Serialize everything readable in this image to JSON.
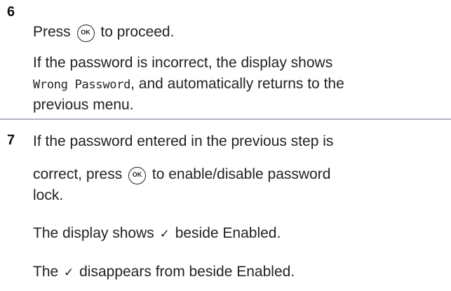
{
  "step6": {
    "number": "6",
    "line1_before": "Press",
    "ok_icon": "OK",
    "line1_after": "to proceed.",
    "para_line1": "If the password is incorrect, the display shows",
    "lcd_text": "Wrong Password",
    "para_line2_after": ", and automatically returns to the",
    "para_line3": "previous menu."
  },
  "step7": {
    "number": "7",
    "line1": "If the password entered in the previous step is",
    "line2_before": "correct, press",
    "ok_icon": "OK",
    "line2_after": "to enable/disable password",
    "line3": "lock.",
    "enabled_before": "The display shows",
    "check_mark": "✓",
    "enabled_after": "beside Enabled.",
    "disabled_before": "The",
    "disabled_after": "disappears from beside Enabled."
  },
  "icons": {
    "ok_button": "ok-button-icon",
    "check": "check-mark-icon"
  }
}
